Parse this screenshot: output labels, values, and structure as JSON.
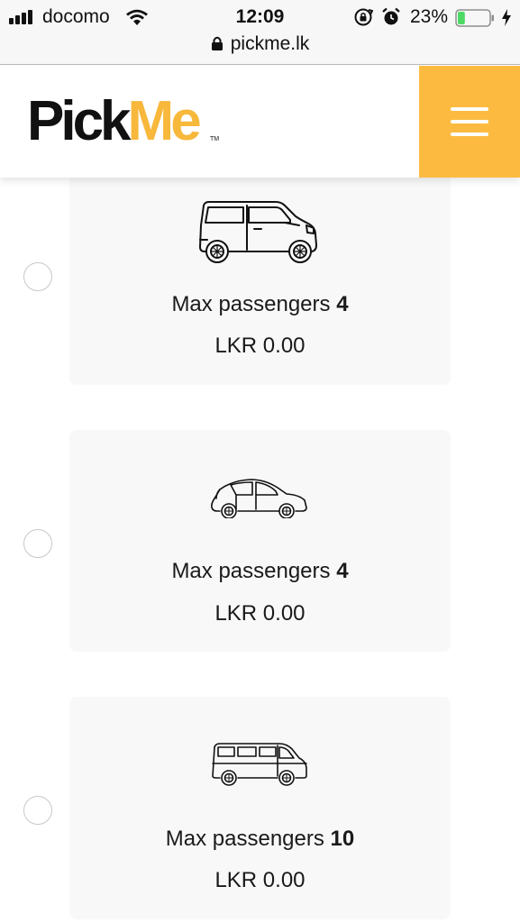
{
  "status_bar": {
    "carrier": "docomo",
    "time": "12:09",
    "battery_percent": "23%",
    "battery_level": 0.23,
    "battery_color": "#4cd964",
    "url": "pickme.lk"
  },
  "header": {
    "logo_pick": "Pick",
    "logo_me": "Me",
    "logo_tm": "TM",
    "brand_color": "#fcbb40",
    "menu_icon": "hamburger-menu-icon"
  },
  "vehicle_options": [
    {
      "vehicle_icon": "minivan-icon",
      "passengers_label": "Max passengers",
      "passengers_count": "4",
      "price": "LKR 0.00"
    },
    {
      "vehicle_icon": "hatchback-car-icon",
      "passengers_label": "Max passengers",
      "passengers_count": "4",
      "price": "LKR 0.00"
    },
    {
      "vehicle_icon": "van-icon",
      "passengers_label": "Max passengers",
      "passengers_count": "10",
      "price": "LKR 0.00"
    }
  ]
}
